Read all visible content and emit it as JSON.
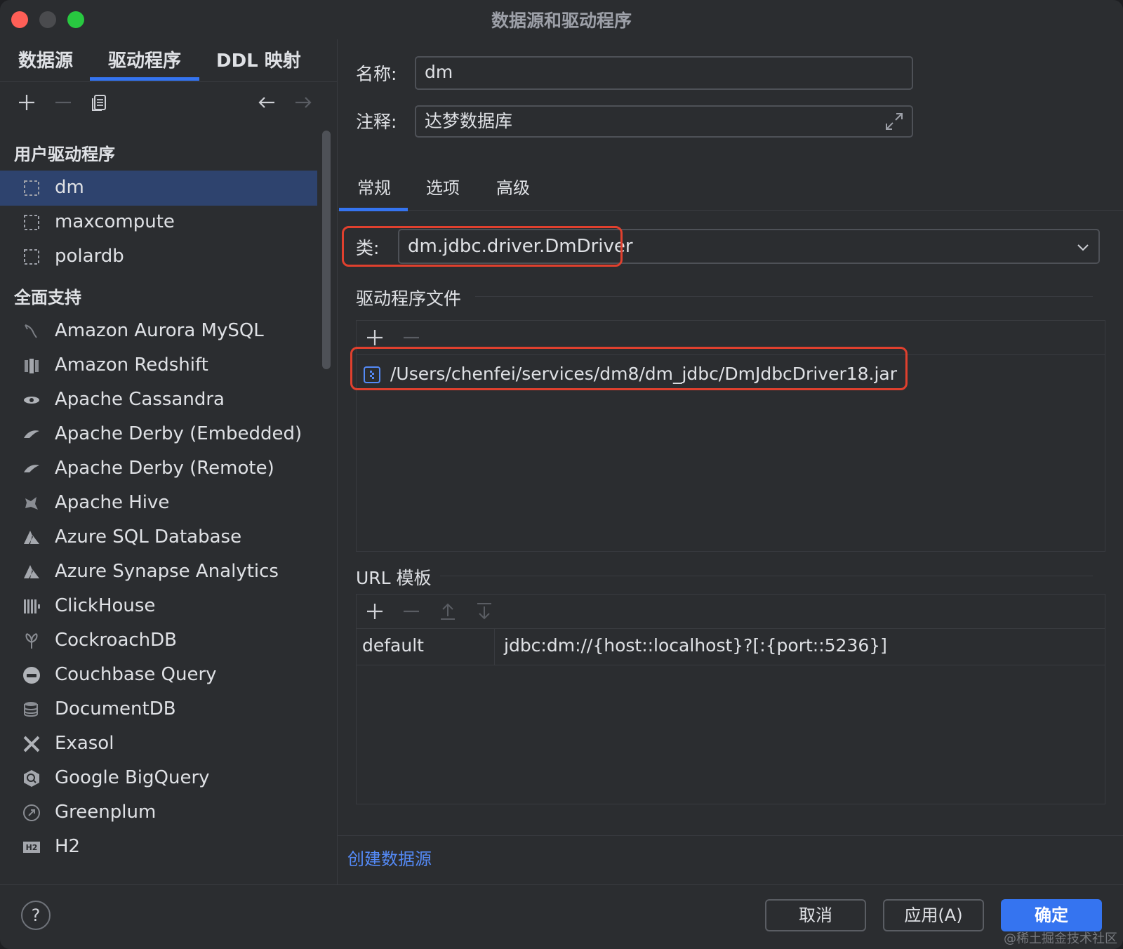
{
  "window": {
    "title": "数据源和驱动程序"
  },
  "left_tabs": [
    "数据源",
    "驱动程序",
    "DDL 映射"
  ],
  "groups": {
    "user": "用户驱动程序",
    "full": "全面支持"
  },
  "user_drivers": [
    "dm",
    "maxcompute",
    "polardb"
  ],
  "full_support": [
    {
      "label": "Amazon Aurora MySQL",
      "icon": "dolphin-icon"
    },
    {
      "label": "Amazon Redshift",
      "icon": "redshift-icon"
    },
    {
      "label": "Apache Cassandra",
      "icon": "eye-icon"
    },
    {
      "label": "Apache Derby (Embedded)",
      "icon": "hat-icon"
    },
    {
      "label": "Apache Derby (Remote)",
      "icon": "hat-icon"
    },
    {
      "label": "Apache Hive",
      "icon": "bee-icon"
    },
    {
      "label": "Azure SQL Database",
      "icon": "azure-icon"
    },
    {
      "label": "Azure Synapse Analytics",
      "icon": "azure-icon"
    },
    {
      "label": "ClickHouse",
      "icon": "clickhouse-icon"
    },
    {
      "label": "CockroachDB",
      "icon": "cockroach-icon"
    },
    {
      "label": "Couchbase Query",
      "icon": "couchbase-icon"
    },
    {
      "label": "DocumentDB",
      "icon": "database-icon"
    },
    {
      "label": "Exasol",
      "icon": "x-icon"
    },
    {
      "label": "Google BigQuery",
      "icon": "bigquery-icon"
    },
    {
      "label": "Greenplum",
      "icon": "greenplum-icon"
    },
    {
      "label": "H2",
      "icon": "h2-icon"
    }
  ],
  "form": {
    "name_label": "名称:",
    "name_value": "dm",
    "comment_label": "注释:",
    "comment_value": "达梦数据库"
  },
  "right_tabs": [
    "常规",
    "选项",
    "高级"
  ],
  "class": {
    "label": "类:",
    "value": "dm.jdbc.driver.DmDriver"
  },
  "driver_files": {
    "title": "驱动程序文件",
    "files": [
      "/Users/chenfei/services/dm8/dm_jdbc/DmJdbcDriver18.jar"
    ]
  },
  "url_templates": {
    "title": "URL 模板",
    "rows": [
      {
        "name": "default",
        "template": "jdbc:dm://{host::localhost}?[:{port::5236}]"
      }
    ]
  },
  "create_link": "创建数据源",
  "buttons": {
    "help": "?",
    "cancel": "取消",
    "apply": "应用(A)",
    "ok": "确定"
  },
  "watermark": "@稀土掘金技术社区",
  "colors": {
    "accent": "#3574f0",
    "highlight": "#e0402e",
    "link": "#548af7",
    "selection": "#2e436e"
  }
}
